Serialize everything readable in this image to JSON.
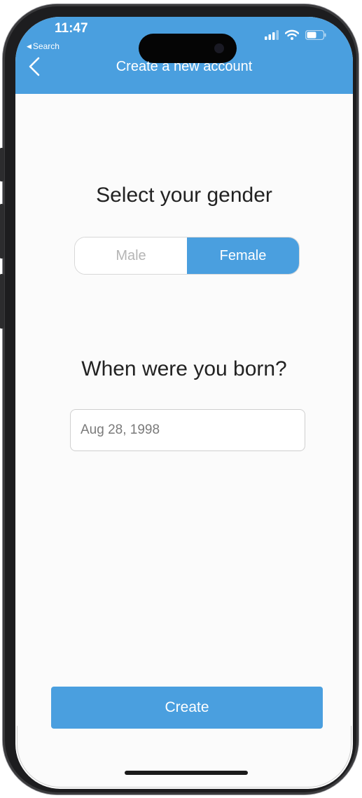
{
  "status_bar": {
    "time": "11:47",
    "back_app_label": "Search",
    "back_app_icon": "left-triangle-icon",
    "icons": [
      "cellular-signal-icon",
      "wifi-icon",
      "battery-icon"
    ]
  },
  "nav": {
    "back_icon": "chevron-left-icon",
    "title": "Create a new account"
  },
  "gender": {
    "heading": "Select your gender",
    "options": [
      "Male",
      "Female"
    ],
    "selected": "Female"
  },
  "birth": {
    "heading": "When were you born?",
    "date_value": "Aug 28, 1998"
  },
  "actions": {
    "create_label": "Create"
  },
  "colors": {
    "accent": "#4a9fdf",
    "unselected_text": "#b5b5b5",
    "heading_text": "#222222"
  }
}
